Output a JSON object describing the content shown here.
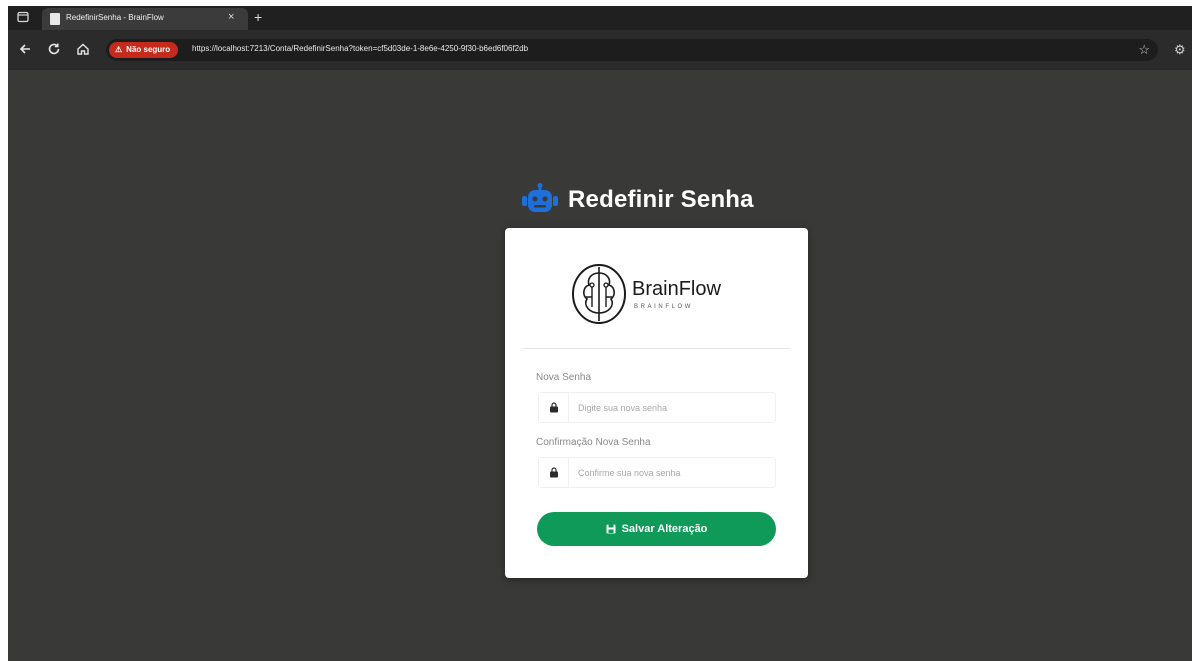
{
  "browser": {
    "tab_title": "RedefinirSenha - BrainFlow",
    "tab_close": "×",
    "new_tab": "+",
    "security_label": "Não seguro",
    "url": "https://localhost:7213/Conta/RedefinirSenha?token=cf5d03de-1-8e6e-4250-9f30-b6ed6f06f2db"
  },
  "page": {
    "title": "Redefinir Senha"
  },
  "brand": {
    "name": "BrainFlow",
    "subtitle": "BRAINFLOW"
  },
  "form": {
    "new_password": {
      "label": "Nova Senha",
      "placeholder": "Digite sua nova senha"
    },
    "confirm_password": {
      "label": "Confirmação Nova Senha",
      "placeholder": "Confirme sua nova senha"
    },
    "submit_label": "Salvar Alteração"
  },
  "icons": {
    "window": "window-icon",
    "back": "back-arrow-icon",
    "reload": "reload-icon",
    "home": "home-icon",
    "star": "star-icon",
    "settings": "gear-icon",
    "robot": "robot-icon",
    "brain": "brain-icon",
    "lock": "lock-icon",
    "save": "save-icon"
  },
  "colors": {
    "background": "#393937",
    "card": "#ffffff",
    "accent_blue": "#1e6fd9",
    "button_green": "#0f9a5a",
    "not_secure_red": "#c42b1c"
  }
}
